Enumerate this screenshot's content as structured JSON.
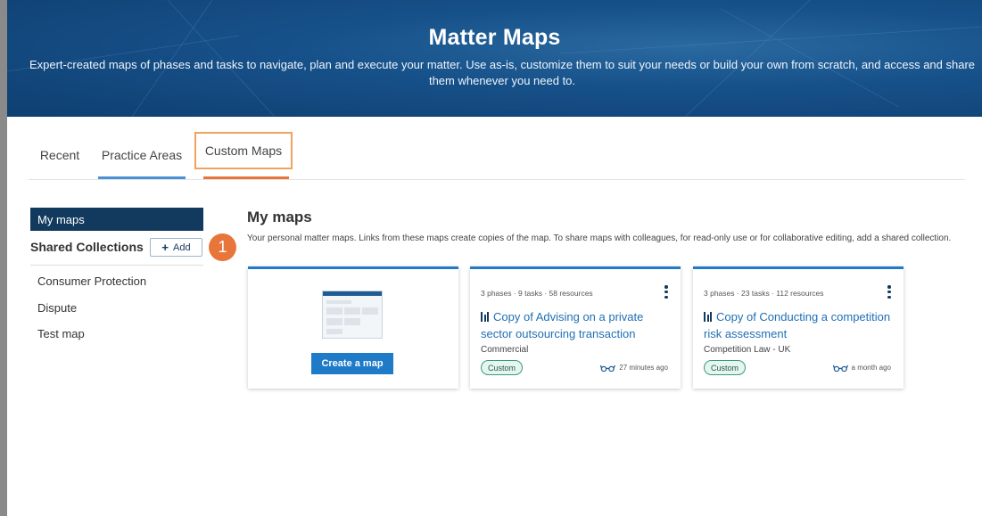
{
  "header": {
    "title": "Matter Maps",
    "subtitle": "Expert-created maps of phases and tasks to navigate, plan and execute your matter. Use as-is, customize them to suit your needs or build your own from scratch, and access and share them whenever you need to."
  },
  "tabs": [
    {
      "label": "Recent"
    },
    {
      "label": "Practice Areas"
    },
    {
      "label": "Custom Maps"
    }
  ],
  "sidebar": {
    "my_maps": "My maps",
    "shared_collections": "Shared Collections",
    "add_label": "Add",
    "items": [
      {
        "label": "Consumer Protection"
      },
      {
        "label": "Dispute"
      },
      {
        "label": "Test map"
      }
    ]
  },
  "callout_number": "1",
  "main": {
    "title": "My maps",
    "description": "Your personal matter maps. Links from these maps create copies of the map. To share maps with colleagues, for read-only use or for collaborative editing, add a shared collection.",
    "create_button": "Create a map",
    "cards": [
      {
        "meta": "3 phases · 9 tasks · 58 resources",
        "title": "Copy of Advising on a private sector outsourcing transaction",
        "area": "Commercial",
        "tag": "Custom",
        "time": "27 minutes ago"
      },
      {
        "meta": "3 phases · 23 tasks · 112 resources",
        "title": "Copy of Conducting a competition risk assessment",
        "area": "Competition Law - UK",
        "tag": "Custom",
        "time": "a month ago"
      }
    ]
  },
  "colors": {
    "banner": "#17518a",
    "nav_dark": "#123a5e",
    "accent_blue": "#1f7ac7",
    "accent_orange": "#e8763a",
    "tag_green": "#3a9a78"
  }
}
